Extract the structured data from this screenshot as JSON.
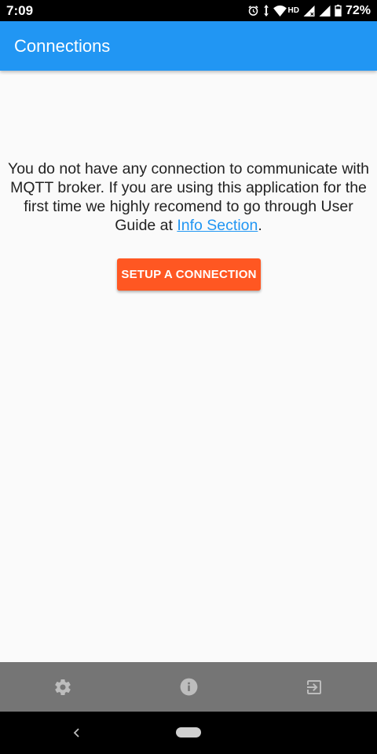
{
  "status_bar": {
    "time": "7:09",
    "network_label": "HD",
    "battery": "72%"
  },
  "app_bar": {
    "title": "Connections"
  },
  "content": {
    "message_text": "You do not have any connection to communicate with MQTT broker. If you are using this application for the first time we highly recomend to go through User Guide at ",
    "link_text": "Info Section",
    "message_end": ".",
    "setup_button_label": "SETUP A CONNECTION"
  },
  "bottom_bar": {
    "items": [
      {
        "icon": "gear-icon"
      },
      {
        "icon": "info-icon"
      },
      {
        "icon": "exit-icon"
      }
    ]
  },
  "colors": {
    "app_bar": "#2196f3",
    "accent_button": "#ff5722",
    "link": "#2196f3",
    "bottom_bar": "#757575"
  }
}
